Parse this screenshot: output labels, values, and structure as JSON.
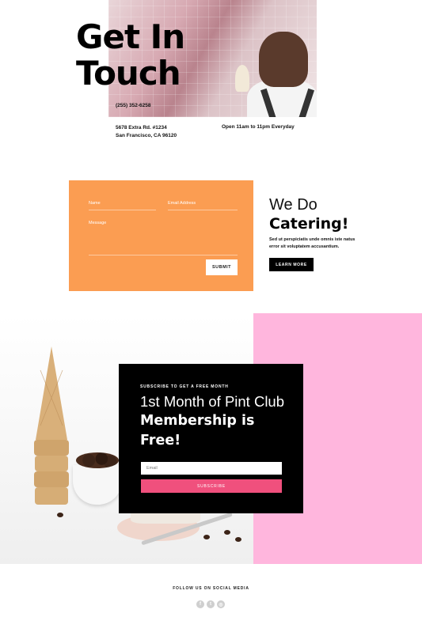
{
  "hero": {
    "title_line1": "Get In",
    "title_line2": "Touch",
    "phone": "(255) 352-6258",
    "address_line1": "5678 Extra Rd. #1234",
    "address_line2": "San Francisco, CA 96120",
    "hours": "Open 11am to 11pm Everyday"
  },
  "contact_form": {
    "name_label": "Name",
    "email_label": "Email Address",
    "message_label": "Message",
    "submit_label": "SUBMIT",
    "background_color": "#fb9d52"
  },
  "catering": {
    "title_light": "We Do",
    "title_bold": "Catering!",
    "description": "Sed ut perspiciatis unde omnis iste natus error sit voluptatem accusantium.",
    "button_label": "LEARN MORE"
  },
  "subscribe": {
    "eyebrow": "SUBSCRIBE TO GET A FREE MONTH",
    "title_light": "1st Month of Pint Club",
    "title_bold": "Membership is Free!",
    "email_placeholder": "Email",
    "button_label": "SUBSCRIBE",
    "button_color": "#f0507d",
    "accent_block_color": "#ffb6dd"
  },
  "footer": {
    "follow_label": "FOLLOW US ON SOCIAL MEDIA",
    "social_icons": [
      "facebook-icon",
      "twitter-icon",
      "instagram-icon"
    ]
  }
}
